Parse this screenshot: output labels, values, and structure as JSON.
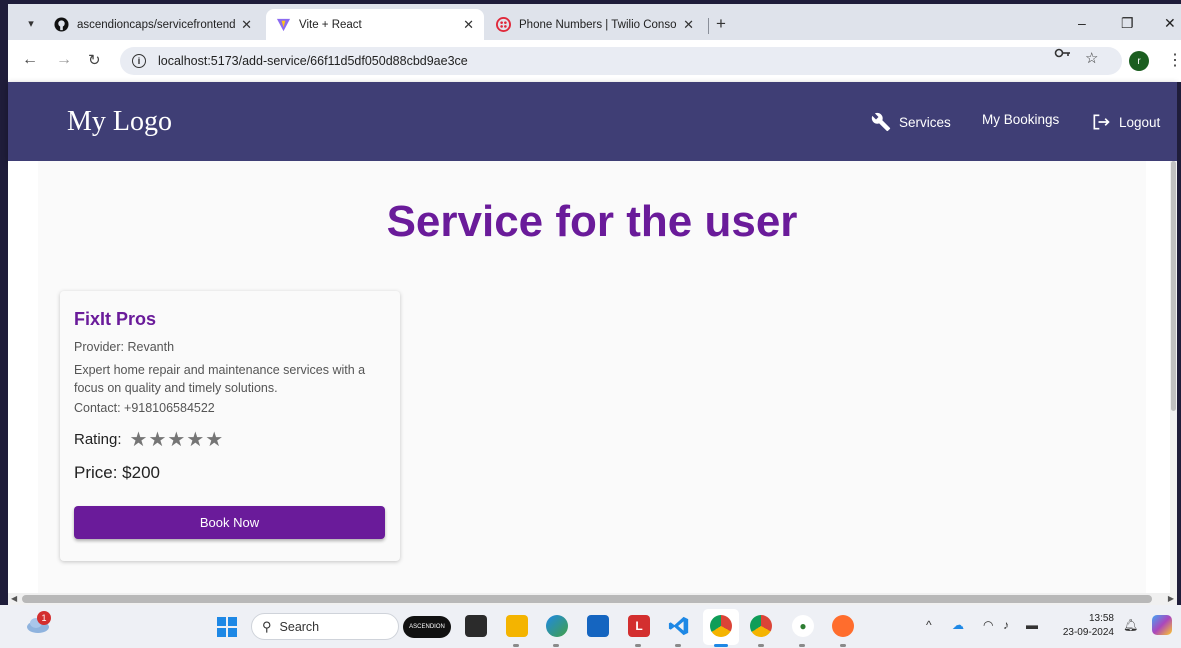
{
  "browser": {
    "tabs": [
      {
        "title": "ascendioncaps/servicefrontend",
        "close": "✕"
      },
      {
        "title": "Vite + React",
        "close": "✕"
      },
      {
        "title": "Phone Numbers | Twilio Console",
        "close": "✕"
      }
    ],
    "new_tab": "+",
    "window_controls": {
      "minimize": "–",
      "restore": "❐",
      "close": "✕"
    },
    "url": "localhost:5173/add-service/66f11d5df050d88cbd9ae3ce",
    "profile_initial": "r"
  },
  "header": {
    "logo": "My Logo",
    "nav": {
      "services": "Services",
      "bookings": "My Bookings",
      "logout": "Logout"
    }
  },
  "main": {
    "title": "Service for the user",
    "card": {
      "name": "FixIt Pros",
      "provider": "Provider: Revanth",
      "description": "Expert home repair and maintenance services with a focus on quality and timely solutions.",
      "contact": "Contact: +918106584522",
      "rating_label": "Rating:",
      "rating_value": 5,
      "rating_max": 5,
      "stars": "★★★★★",
      "price": "Price: $200",
      "book_button": "Book Now"
    }
  },
  "taskbar": {
    "search_placeholder": "Search",
    "pill_label": "ASCENDION",
    "notification_badge": "1",
    "time": "13:58",
    "date": "23-09-2024"
  },
  "colors": {
    "accent": "#6a1b9a",
    "header_bg": "#3f3e75"
  }
}
